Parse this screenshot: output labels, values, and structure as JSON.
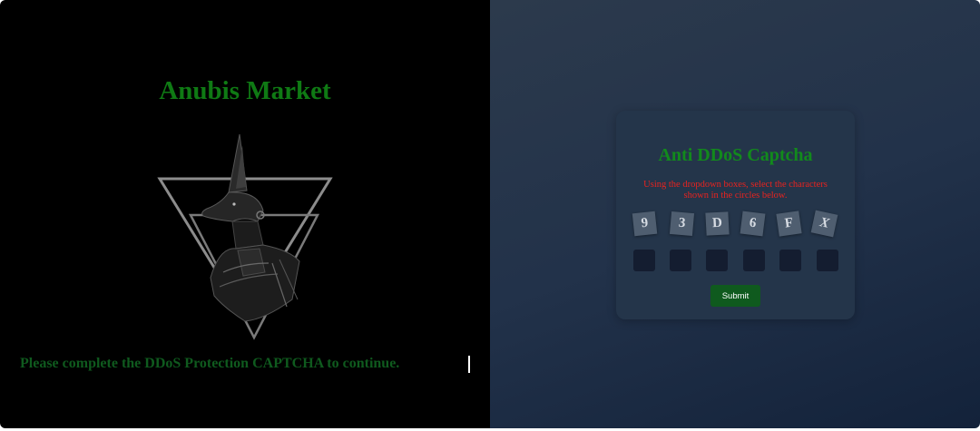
{
  "left": {
    "title": "Anubis Market",
    "message": "Please complete the DDoS Protection CAPTCHA to continue."
  },
  "captcha": {
    "title": "Anti DDoS Captcha",
    "instructions": "Using the dropdown boxes, select the characters shown in the circles below.",
    "characters": [
      "9",
      "3",
      "D",
      "6",
      "F",
      "X"
    ],
    "select_count": 6,
    "submit_label": "Submit"
  },
  "colors": {
    "title_green": "#0f7a14",
    "message_green": "#0f5a1e",
    "instruction_red": "#e8231f",
    "button_green": "#0f5a1e"
  }
}
